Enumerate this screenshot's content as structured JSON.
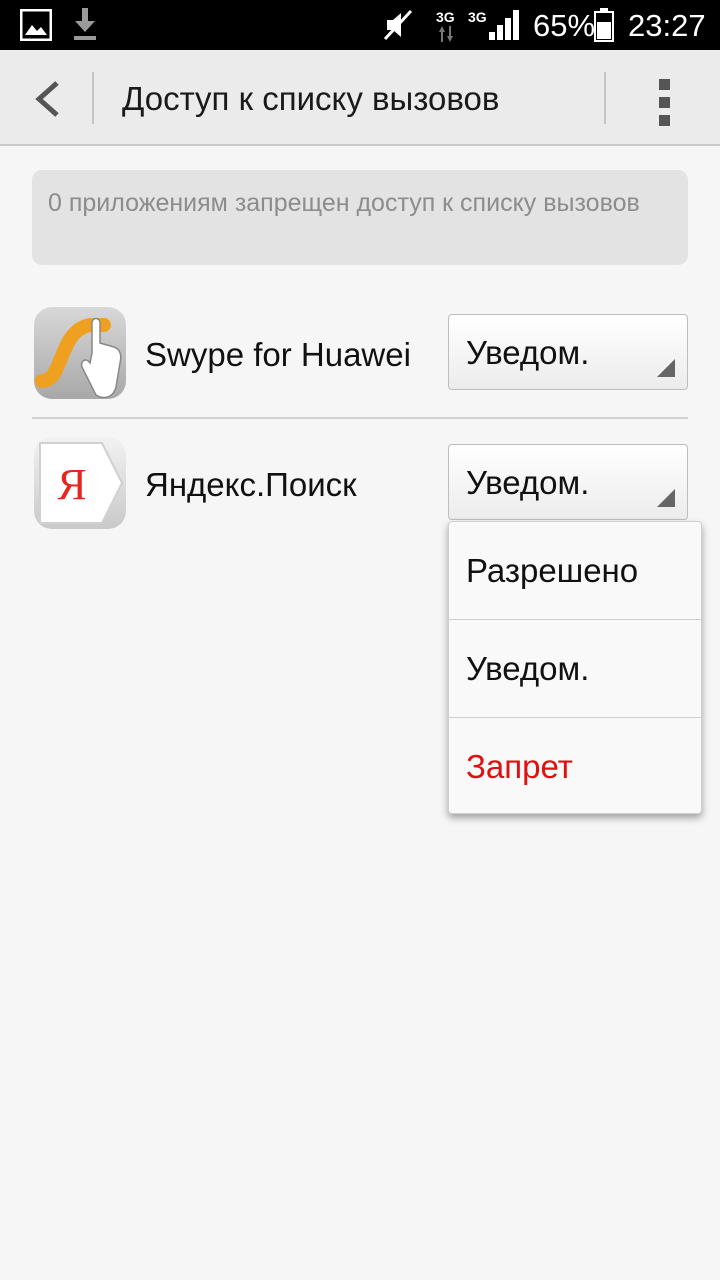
{
  "status_bar": {
    "icons": [
      "image-icon",
      "download-icon",
      "mute-icon",
      "3g-icon",
      "3g-icon",
      "signal-icon",
      "battery-icon"
    ],
    "network_1": "3G",
    "network_2": "3G",
    "battery": "65%",
    "time": "23:27"
  },
  "action_bar": {
    "title": "Доступ к списку вызовов",
    "back_icon": "chevron-left-icon",
    "overflow_icon": "overflow-menu-icon"
  },
  "banner": {
    "text": "0 приложениям запрещен доступ к списку вызовов"
  },
  "apps": [
    {
      "name": "Swype for Huawei",
      "icon": "swype-icon",
      "permission": "Уведом."
    },
    {
      "name": "Яндекс.Поиск",
      "icon": "yandex-icon",
      "icon_letter": "Я",
      "permission": "Уведом."
    }
  ],
  "dropdown": {
    "options": [
      {
        "label": "Разрешено",
        "color": "#111111"
      },
      {
        "label": "Уведом.",
        "color": "#111111"
      },
      {
        "label": "Запрет",
        "color": "#e01010"
      }
    ]
  }
}
